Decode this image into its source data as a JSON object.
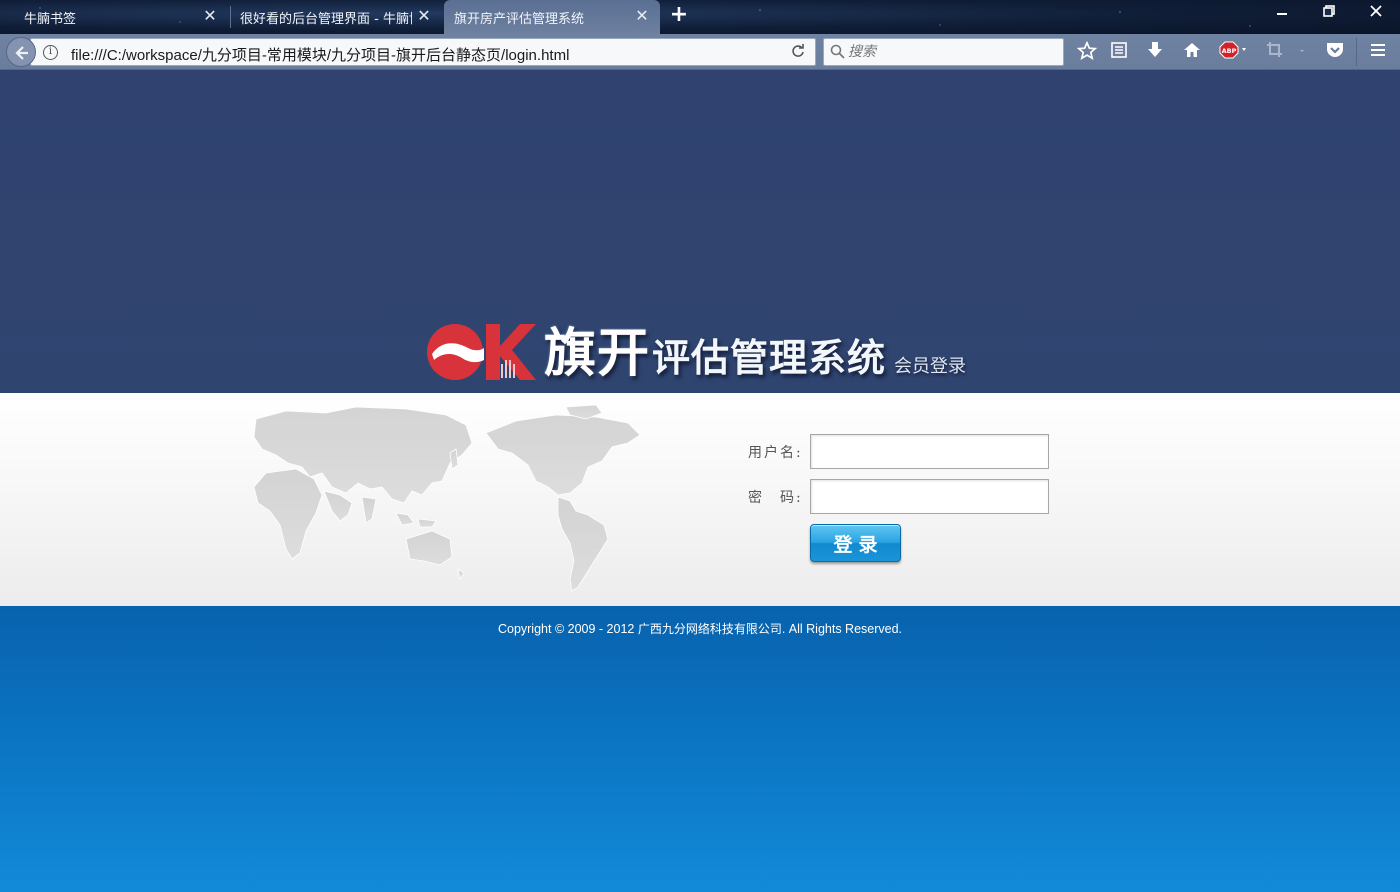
{
  "browser": {
    "tabs": [
      {
        "title": "牛腩书签",
        "active": false
      },
      {
        "title": "很好看的后台管理界面 - 牛腩博",
        "active": false
      },
      {
        "title": "旗开房产评估管理系统",
        "active": true
      }
    ],
    "close_glyph": "✕",
    "new_tab_glyph": "+",
    "url": "file:///C:/workspace/九分项目-常用模块/九分项目-旗开后台静态页/login.html",
    "search_placeholder": "搜索",
    "toolbar_icons": [
      "bookmark-star-icon",
      "reader-list-icon",
      "download-icon",
      "home-icon",
      "adblock-icon",
      "screenshot-icon",
      "pocket-icon",
      "menu-icon"
    ],
    "window_controls": [
      "minimize-icon",
      "restore-icon",
      "close-icon"
    ]
  },
  "logo": {
    "mark": "OK",
    "title": "旗开",
    "title_rest": "评估管理系统",
    "subtitle": "会员登录",
    "mark_color": "#d8323a"
  },
  "login_form": {
    "username_label": "用户名:",
    "password_label": "密　码:",
    "username_value": "",
    "password_value": "",
    "submit_label": "登录"
  },
  "footer": {
    "copyright_prefix": "Copyright © 2009 - 2012 ",
    "company": "广西九分网络科技有限公司",
    "copyright_suffix": ". All Rights Reserved."
  },
  "colors": {
    "top_band": "#2f4270",
    "bottom_band": "#0a72c0",
    "button": "#1a95d8"
  }
}
